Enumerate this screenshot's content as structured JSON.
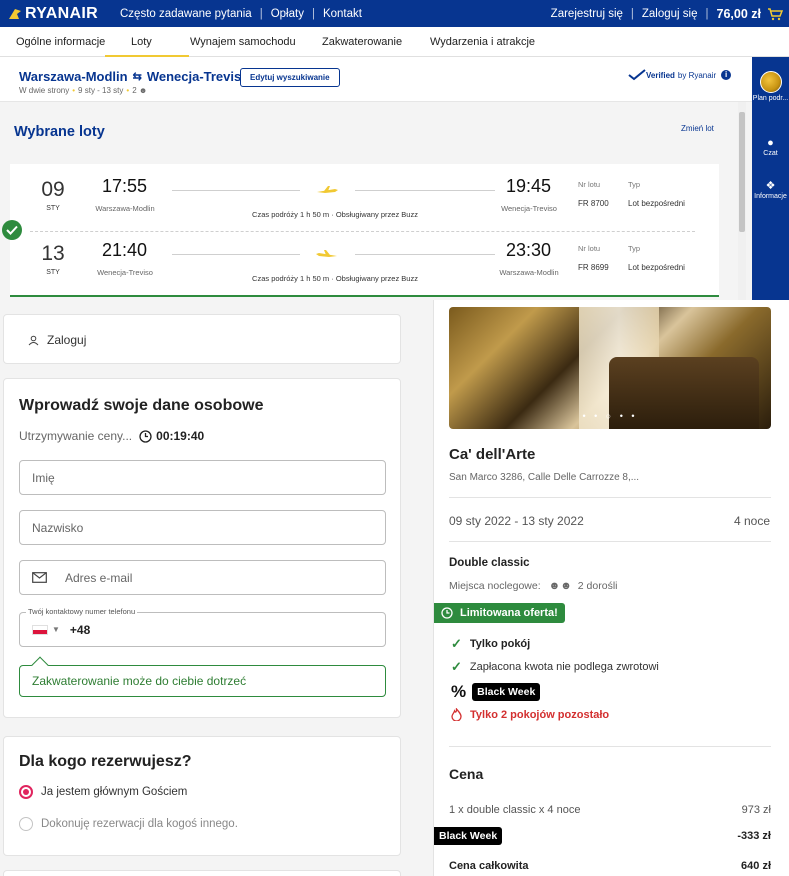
{
  "topbar": {
    "brand": "RYANAIR",
    "nav": [
      "Często zadawane pytania",
      "Opłaty",
      "Kontakt"
    ],
    "register": "Zarejestruj się",
    "login": "Zaloguj się",
    "price": "76,00 zł",
    "bg_color": "#073590"
  },
  "tabs": [
    {
      "label": "Ogólne informacje"
    },
    {
      "label": "Loty",
      "active": true
    },
    {
      "label": "Wynajem samochodu"
    },
    {
      "label": "Zakwaterowanie"
    },
    {
      "label": "Wydarzenia i atrakcje"
    }
  ],
  "search": {
    "origin": "Warszawa-Modlin",
    "destination": "Wenecja-Treviso",
    "edit_label": "Edytuj wyszukiwanie",
    "trip_type": "W dwie strony",
    "dates": "9 sty - 13 sty",
    "passengers": "2",
    "verified": "Verified",
    "verified_by": "by Ryanair"
  },
  "rail": {
    "plan": "Plan podr...",
    "chat": "Czat",
    "info": "Informacje"
  },
  "flights": {
    "title": "Wybrane loty",
    "change": "Zmień lot",
    "legs": [
      {
        "day": "09",
        "month": "STY",
        "dep_time": "17:55",
        "dep_city": "Warszawa-Modlin",
        "duration": "Czas podróży 1 h 50 m · Obsługiwany przez Buzz",
        "arr_time": "19:45",
        "arr_city": "Wenecja-Treviso",
        "flight_label": "Nr lotu",
        "flight_no": "FR 8700",
        "type_label": "Typ",
        "type": "Lot bezpośredni"
      },
      {
        "day": "13",
        "month": "STY",
        "dep_time": "21:40",
        "dep_city": "Wenecja-Treviso",
        "duration": "Czas podróży 1 h 50 m · Obsługiwany przez Buzz",
        "arr_time": "23:30",
        "arr_city": "Warszawa-Modlin",
        "flight_label": "Nr lotu",
        "flight_no": "FR 8699",
        "type_label": "Typ",
        "type": "Lot bezpośredni"
      }
    ]
  },
  "login_panel": {
    "label": "Zaloguj"
  },
  "personal": {
    "title": "Wprowadź swoje dane osobowe",
    "hold_label": "Utrzymywanie ceny...",
    "hold_timer": "00:19:40",
    "first_name_placeholder": "Imię",
    "last_name_placeholder": "Nazwisko",
    "email_placeholder": "Adres e-mail",
    "phone_legend": "Twój kontaktowy numer telefonu",
    "phone_prefix": "+48",
    "tip": "Zakwaterowanie może do ciebie dotrzeć"
  },
  "for_who": {
    "title": "Dla kogo rezerwujesz?",
    "option_main": "Ja jestem głównym Gościem",
    "option_other": "Dokonuję rezerwacji dla kogoś innego."
  },
  "hotel": {
    "name": "Ca' dell'Arte",
    "address": "San Marco 3286, Calle Delle Carrozze 8,...",
    "dates": "09 sty 2022 - 13 sty 2022",
    "nights": "4 noce",
    "room": "Double classic",
    "beds_label": "Miejsca noclegowe:",
    "guests": "2 dorośli",
    "limited_offer": "Limitowana oferta!",
    "room_only": "Tylko pokój",
    "non_refundable": "Zapłacona kwota nie podlega zwrotowi",
    "black_week": "Black Week",
    "rooms_left": "Tylko 2 pokojów pozostało",
    "price_title": "Cena",
    "line_label": "1 x double classic x 4 noce",
    "line_price": "973 zł",
    "discount_label": "Black Week",
    "discount": "-333 zł",
    "total_label": "Cena całkowita",
    "total": "640 zł",
    "accent_green": "#2e8b3e"
  }
}
